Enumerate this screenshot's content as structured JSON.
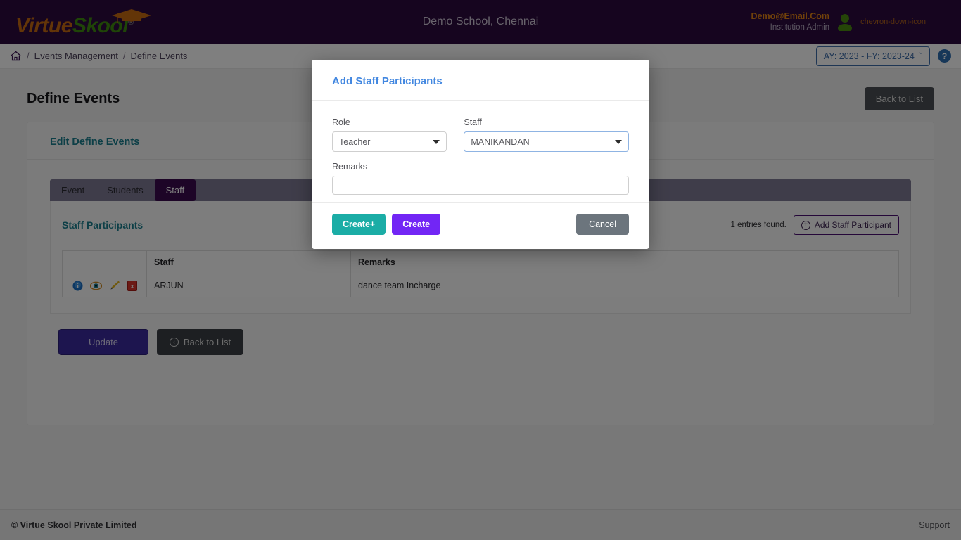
{
  "header": {
    "logo_part1": "Virtue",
    "logo_part2": "Skool",
    "logo_registered": "®",
    "logo_icon": "graduation-cap-icon",
    "school_name": "Demo School, Chennai",
    "user_email": "Demo@Email.Com",
    "user_role": "Institution Admin",
    "avatar_icon": "user-avatar-icon",
    "caret_icon": "chevron-down-icon",
    "colors": {
      "bar": "#2d0a3f",
      "email": "#e08214",
      "avatar": "#4a8a10"
    }
  },
  "breadcrumb": {
    "home_icon": "home-icon",
    "separator": "/",
    "items": [
      "Events Management",
      "Define Events"
    ],
    "academic_year": "AY: 2023 - FY: 2023-24",
    "academic_year_caret": "ˇ",
    "help_label": "?"
  },
  "page": {
    "title": "Define Events",
    "back_to_list_top": "Back to List",
    "card_title": "Edit Define Events"
  },
  "tabs": [
    {
      "label": "Event",
      "active": false
    },
    {
      "label": "Students",
      "active": false
    },
    {
      "label": "Staff",
      "active": true
    }
  ],
  "staff_panel": {
    "title": "Staff Participants",
    "entries_found": "1 entries found.",
    "add_button": "Add Staff Participant",
    "add_button_icon": "plus-circle-icon",
    "columns": [
      "",
      "Staff",
      "Remarks"
    ],
    "rows": [
      {
        "icons": [
          "info-icon",
          "view-eye-icon",
          "edit-pencil-icon",
          "delete-icon"
        ],
        "staff": "ARJUN",
        "remarks": "dance team Incharge"
      }
    ]
  },
  "form_actions": {
    "update": "Update",
    "back_to_list": "Back to List",
    "back_icon": "arrow-left-circle-icon"
  },
  "footer": {
    "copyright": "© Virtue Skool Private Limited",
    "support": "Support"
  },
  "modal": {
    "title": "Add Staff Participants",
    "role_label": "Role",
    "role_value": "Teacher",
    "staff_label": "Staff",
    "staff_value": "MANIKANDAN",
    "remarks_label": "Remarks",
    "remarks_value": "",
    "remarks_placeholder": "",
    "create_plus": "Create+",
    "create": "Create",
    "cancel": "Cancel",
    "colors": {
      "title": "#4287e0",
      "create_plus": "#1bada6",
      "create": "#7226f5",
      "cancel": "#6c757d"
    }
  }
}
